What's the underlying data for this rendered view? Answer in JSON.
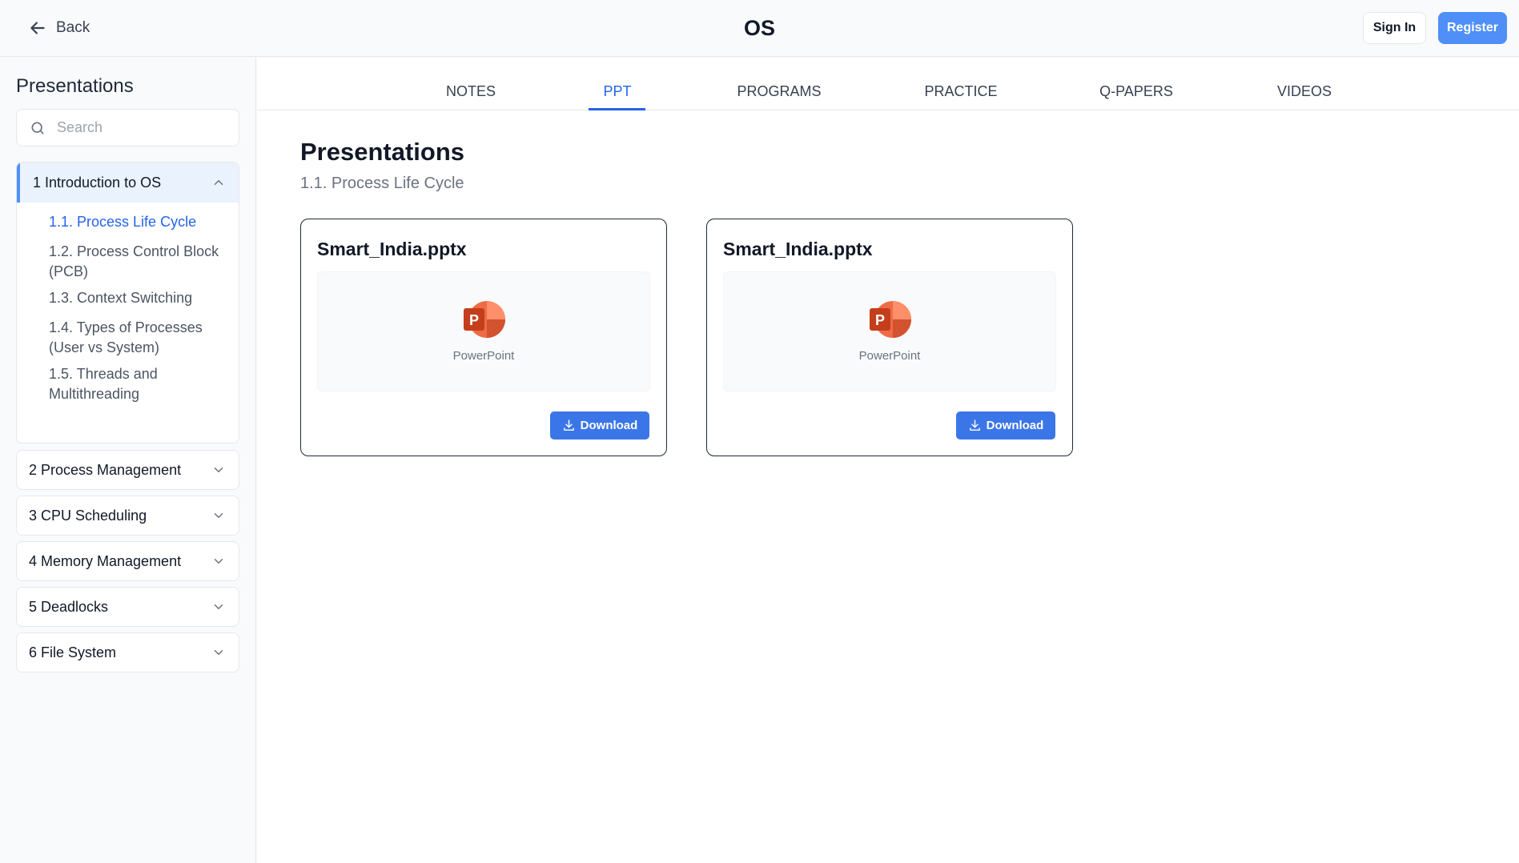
{
  "header": {
    "back_label": "Back",
    "title": "OS",
    "sign_in_label": "Sign In",
    "register_label": "Register"
  },
  "sidebar": {
    "title": "Presentations",
    "search_placeholder": "Search",
    "sections": [
      {
        "label": "1 Introduction to OS",
        "expanded": true,
        "items": [
          {
            "label": "1.1. Process Life Cycle",
            "active": true
          },
          {
            "label": "1.2. Process Control Block (PCB)"
          },
          {
            "label": "1.3. Context Switching"
          },
          {
            "label": "1.4. Types of Processes (User vs System)"
          },
          {
            "label": "1.5. Threads and Multithreading"
          }
        ]
      },
      {
        "label": "2 Process Management",
        "expanded": false
      },
      {
        "label": "3 CPU Scheduling",
        "expanded": false
      },
      {
        "label": "4 Memory Management",
        "expanded": false
      },
      {
        "label": "5 Deadlocks",
        "expanded": false
      },
      {
        "label": "6 File System",
        "expanded": false
      }
    ]
  },
  "tabs": [
    {
      "label": "NOTES"
    },
    {
      "label": "PPT",
      "active": true
    },
    {
      "label": "PROGRAMS"
    },
    {
      "label": "PRACTICE"
    },
    {
      "label": "Q-PAPERS"
    },
    {
      "label": "VIDEOS"
    }
  ],
  "content": {
    "title": "Presentations",
    "subtitle": "1.1. Process Life Cycle",
    "files": [
      {
        "name": "Smart_India.pptx",
        "type_label": "PowerPoint",
        "icon": "powerpoint-icon",
        "download_label": "Download"
      },
      {
        "name": "Smart_India.pptx",
        "type_label": "PowerPoint",
        "icon": "powerpoint-icon",
        "download_label": "Download"
      }
    ]
  },
  "colors": {
    "accent": "#2563eb",
    "register_bg": "#4f8ff7",
    "download_bg": "#3b76e8",
    "active_section_bg": "#eaf2fd",
    "powerpoint": "#d24726"
  }
}
